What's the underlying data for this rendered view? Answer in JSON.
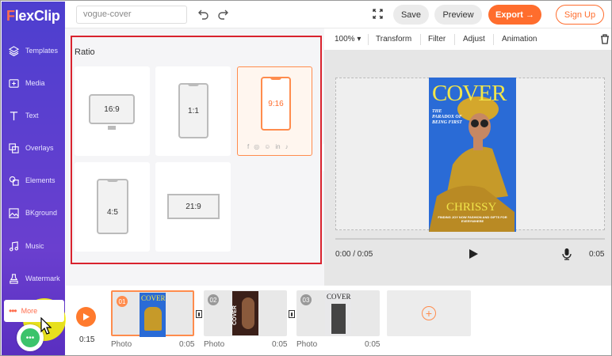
{
  "app": {
    "logo_f": "F",
    "logo_rest": "lexClip"
  },
  "sidebar": {
    "items": [
      {
        "label": "Templates",
        "icon": "layers-icon"
      },
      {
        "label": "Media",
        "icon": "media-icon"
      },
      {
        "label": "Text",
        "icon": "text-icon"
      },
      {
        "label": "Overlays",
        "icon": "overlays-icon"
      },
      {
        "label": "Elements",
        "icon": "elements-icon"
      },
      {
        "label": "BKground",
        "icon": "background-icon"
      },
      {
        "label": "Music",
        "icon": "music-icon"
      },
      {
        "label": "Watermark",
        "icon": "watermark-icon"
      }
    ],
    "more_label": "More"
  },
  "topbar": {
    "project_name": "vogue-cover",
    "save_label": "Save",
    "preview_label": "Preview",
    "export_label": "Export",
    "export_arrow": "→",
    "signup_label": "Sign Up"
  },
  "ratio": {
    "title": "Ratio",
    "options": [
      "16:9",
      "1:1",
      "9:16",
      "4:5",
      "21:9"
    ],
    "selected": "9:16",
    "social_icons": [
      "facebook-icon",
      "instagram-icon",
      "snapchat-icon",
      "linkedin-icon",
      "tiktok-icon"
    ],
    "social_glyphs": [
      "f",
      "◎",
      "☺",
      "in",
      "♪"
    ]
  },
  "toolbar": {
    "zoom": "100%",
    "transform": "Transform",
    "filter": "Filter",
    "adjust": "Adjust",
    "animation": "Animation"
  },
  "cover": {
    "title": "COVER",
    "tagline": "THE PARADOX OF BEING FIRST",
    "name": "CHRISSY",
    "footer": "FINDING JOY NOW FASHION AND GIFTS FOR EVERYWHERE"
  },
  "player": {
    "current": "0:00 / 0:05",
    "duration": "0:05"
  },
  "timeline": {
    "total": "0:15",
    "clips": [
      {
        "num": "01",
        "type": "Photo",
        "duration": "0:05"
      },
      {
        "num": "02",
        "type": "Photo",
        "duration": "0:05"
      },
      {
        "num": "03",
        "type": "Photo",
        "duration": "0:05"
      }
    ],
    "thumb2_text": "COVER",
    "thumb3_text": "COVER"
  },
  "colors": {
    "accent": "#ff6d2d",
    "sidebar": "#5a3fcf",
    "selection": "#d9232e"
  }
}
